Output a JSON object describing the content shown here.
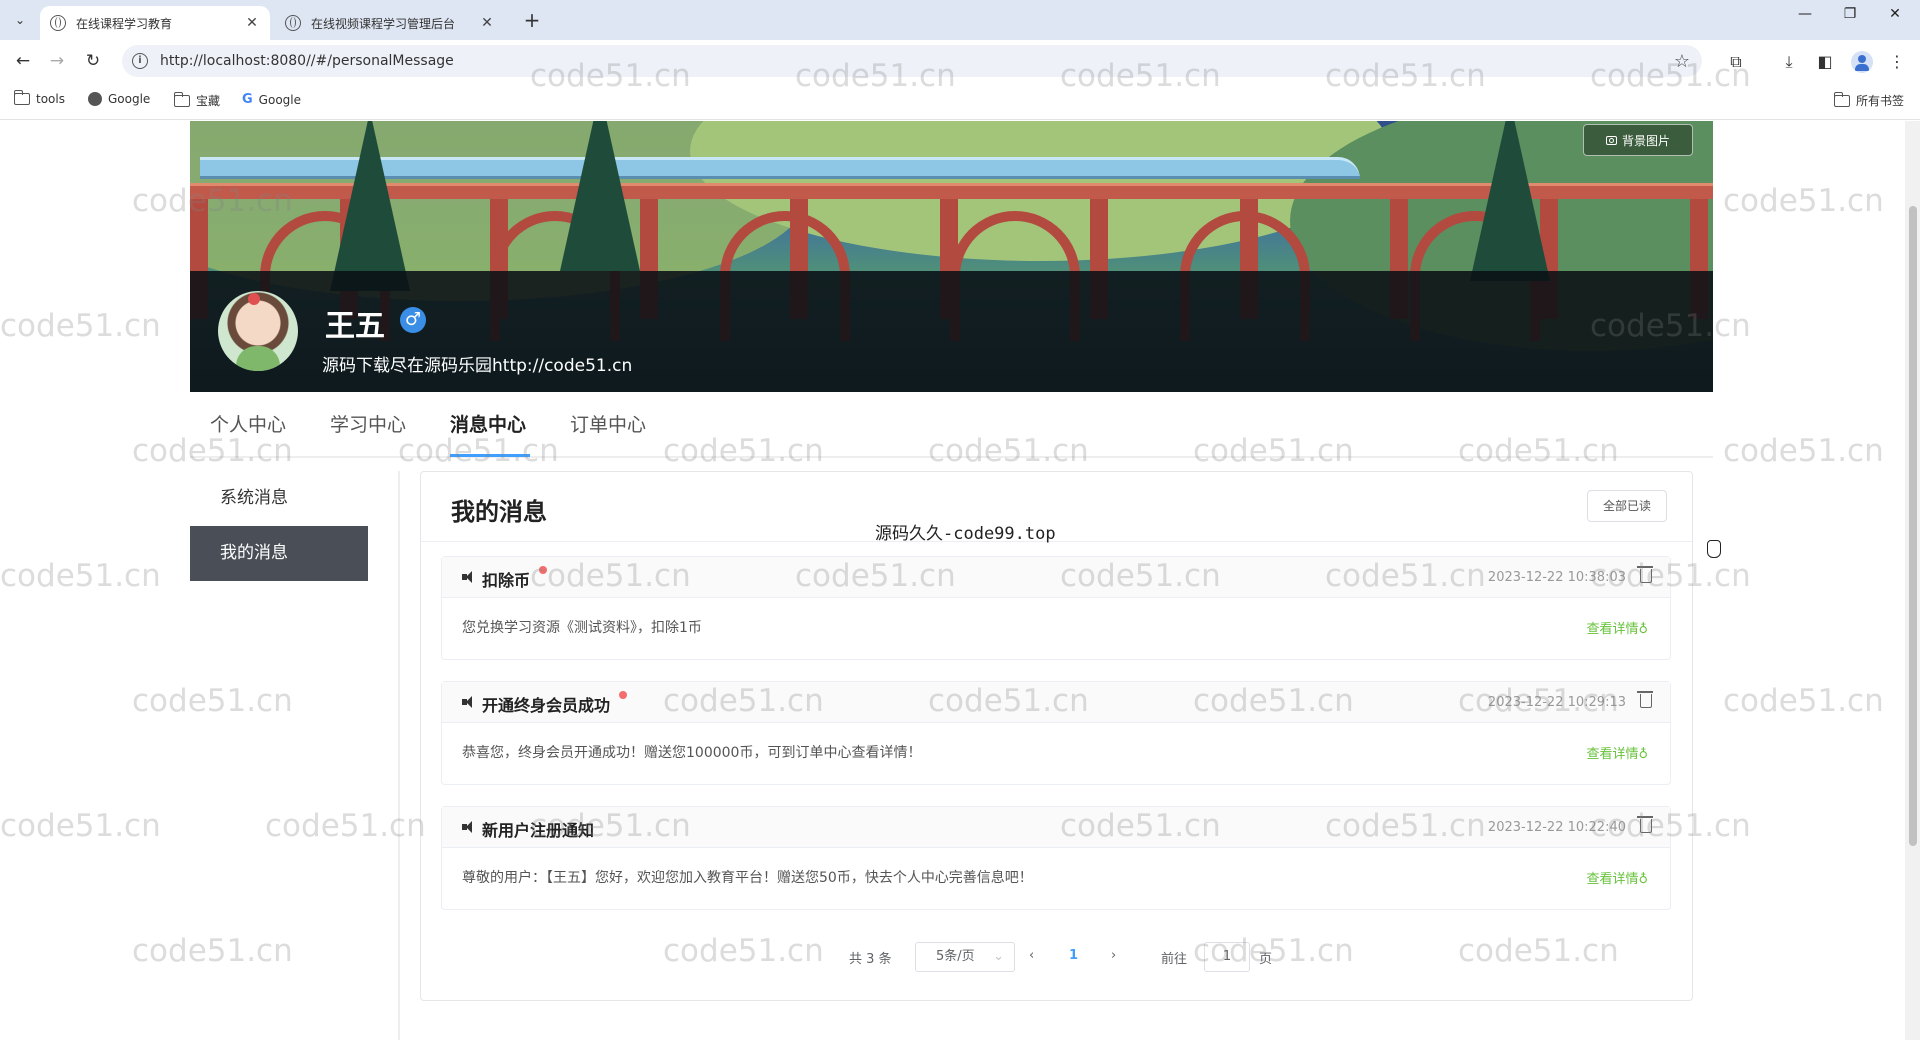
{
  "browser": {
    "tabs": [
      {
        "title": "在线课程学习教育",
        "active": true
      },
      {
        "title": "在线视频课程学习管理后台",
        "active": false
      }
    ],
    "url": "http://localhost:8080//#/personalMessage",
    "bookmarks": [
      {
        "label": "tools",
        "icon": "folder-icon"
      },
      {
        "label": "Google",
        "icon": "globe-icon"
      },
      {
        "label": "宝藏",
        "icon": "folder-icon"
      },
      {
        "label": "Google",
        "icon": "google-icon"
      }
    ],
    "all_bookmarks": "所有书签"
  },
  "profile": {
    "bg_button": "背景图片",
    "name": "王五",
    "gender_symbol": "♂",
    "signature": "源码下载尽在源码乐园http://code51.cn"
  },
  "main_tabs": [
    "个人中心",
    "学习中心",
    "消息中心",
    "订单中心"
  ],
  "active_tab": "消息中心",
  "sidebar": {
    "items": [
      "系统消息",
      "我的消息"
    ],
    "active": "我的消息"
  },
  "messages_panel": {
    "title": "我的消息",
    "read_all": "全部已读",
    "messages": [
      {
        "title": "扣除币",
        "unread": true,
        "time": "2023-12-22 10:38:03",
        "body": "您兑换学习资源《测试资料》，扣除1币",
        "link": "查看详情♁"
      },
      {
        "title": "开通终身会员成功",
        "unread": true,
        "time": "2023-12-22 10:29:13",
        "body": "恭喜您，终身会员开通成功！赠送您100000币，可到订单中心查看详情！",
        "link": "查看详情♁"
      },
      {
        "title": "新用户注册通知",
        "unread": false,
        "time": "2023-12-22 10:22:40",
        "body": "尊敬的用户：【王五】您好，欢迎您加入教育平台！赠送您50币，快去个人中心完善信息吧！",
        "link": "查看详情♁"
      }
    ]
  },
  "pagination": {
    "total": "共 3 条",
    "page_size": "5条/页",
    "current_page": "1",
    "goto_label": "前往",
    "goto_value": "1",
    "page_unit": "页"
  },
  "overlay_text": "源码久久-code99.top",
  "watermark": "code51.cn"
}
